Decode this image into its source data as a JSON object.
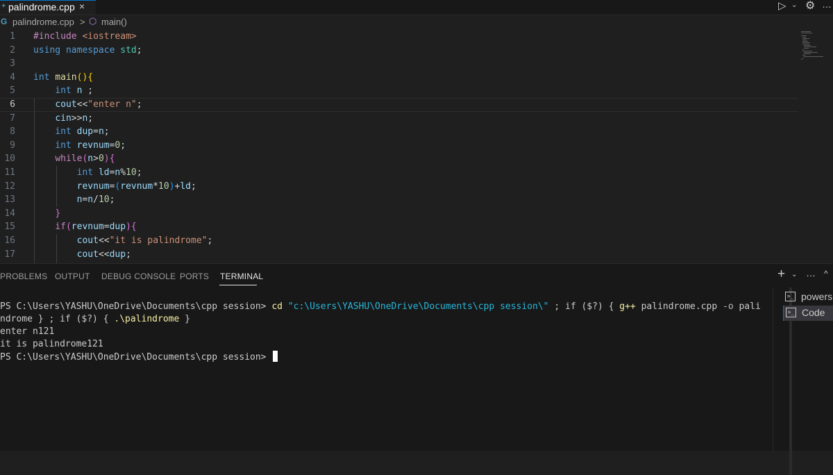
{
  "tabs": [
    {
      "label": "palindrome.cpp",
      "icon": "cpp-file-icon",
      "close": "×"
    }
  ],
  "titlebar_actions": {
    "run": "▷",
    "chevron": "⌄",
    "settings": "⚙",
    "more": "…"
  },
  "breadcrumb": {
    "file": "palindrome.cpp",
    "separator": ">",
    "symbol": "main()"
  },
  "editor": {
    "active_line": 6,
    "line_numbers": [
      "1",
      "2",
      "3",
      "4",
      "5",
      "6",
      "7",
      "8",
      "9",
      "10",
      "11",
      "12",
      "13",
      "14",
      "15",
      "16",
      "17"
    ]
  },
  "panel": {
    "tabs": [
      "PROBLEMS",
      "OUTPUT",
      "DEBUG CONSOLE",
      "PORTS",
      "TERMINAL"
    ],
    "active_tab": "TERMINAL",
    "actions": {
      "new_terminal": "+",
      "chevron": "⌄",
      "more": "…",
      "maximize": "^"
    }
  },
  "terminal": {
    "prompt1": "PS C:\\Users\\YASHU\\OneDrive\\Documents\\cpp session> ",
    "cmd_cd": "cd",
    "cmd_path": " \"c:\\Users\\YASHU\\OneDrive\\Documents\\cpp session\\\"",
    "cmd_sep1": " ; ",
    "cmd_if1": "if ($?) { ",
    "cmd_gpp": "g++",
    "cmd_gpp_args": " palindrome.cpp ",
    "cmd_o": "-o",
    "cmd_pali": " pali",
    "line2_a": "ndrome } ; ",
    "line2_if": "if ($?) { ",
    "line2_exe": ".\\palindrome",
    "line2_end": " }",
    "output1": "enter n121",
    "output2": "it is palindrome121",
    "prompt2": "PS C:\\Users\\YASHU\\OneDrive\\Documents\\cpp session> "
  },
  "terminal_list": [
    {
      "label": "powersh",
      "icon": "terminal-icon",
      "selected": false
    },
    {
      "label": "Code",
      "icon": "terminal-icon",
      "selected": true
    }
  ]
}
